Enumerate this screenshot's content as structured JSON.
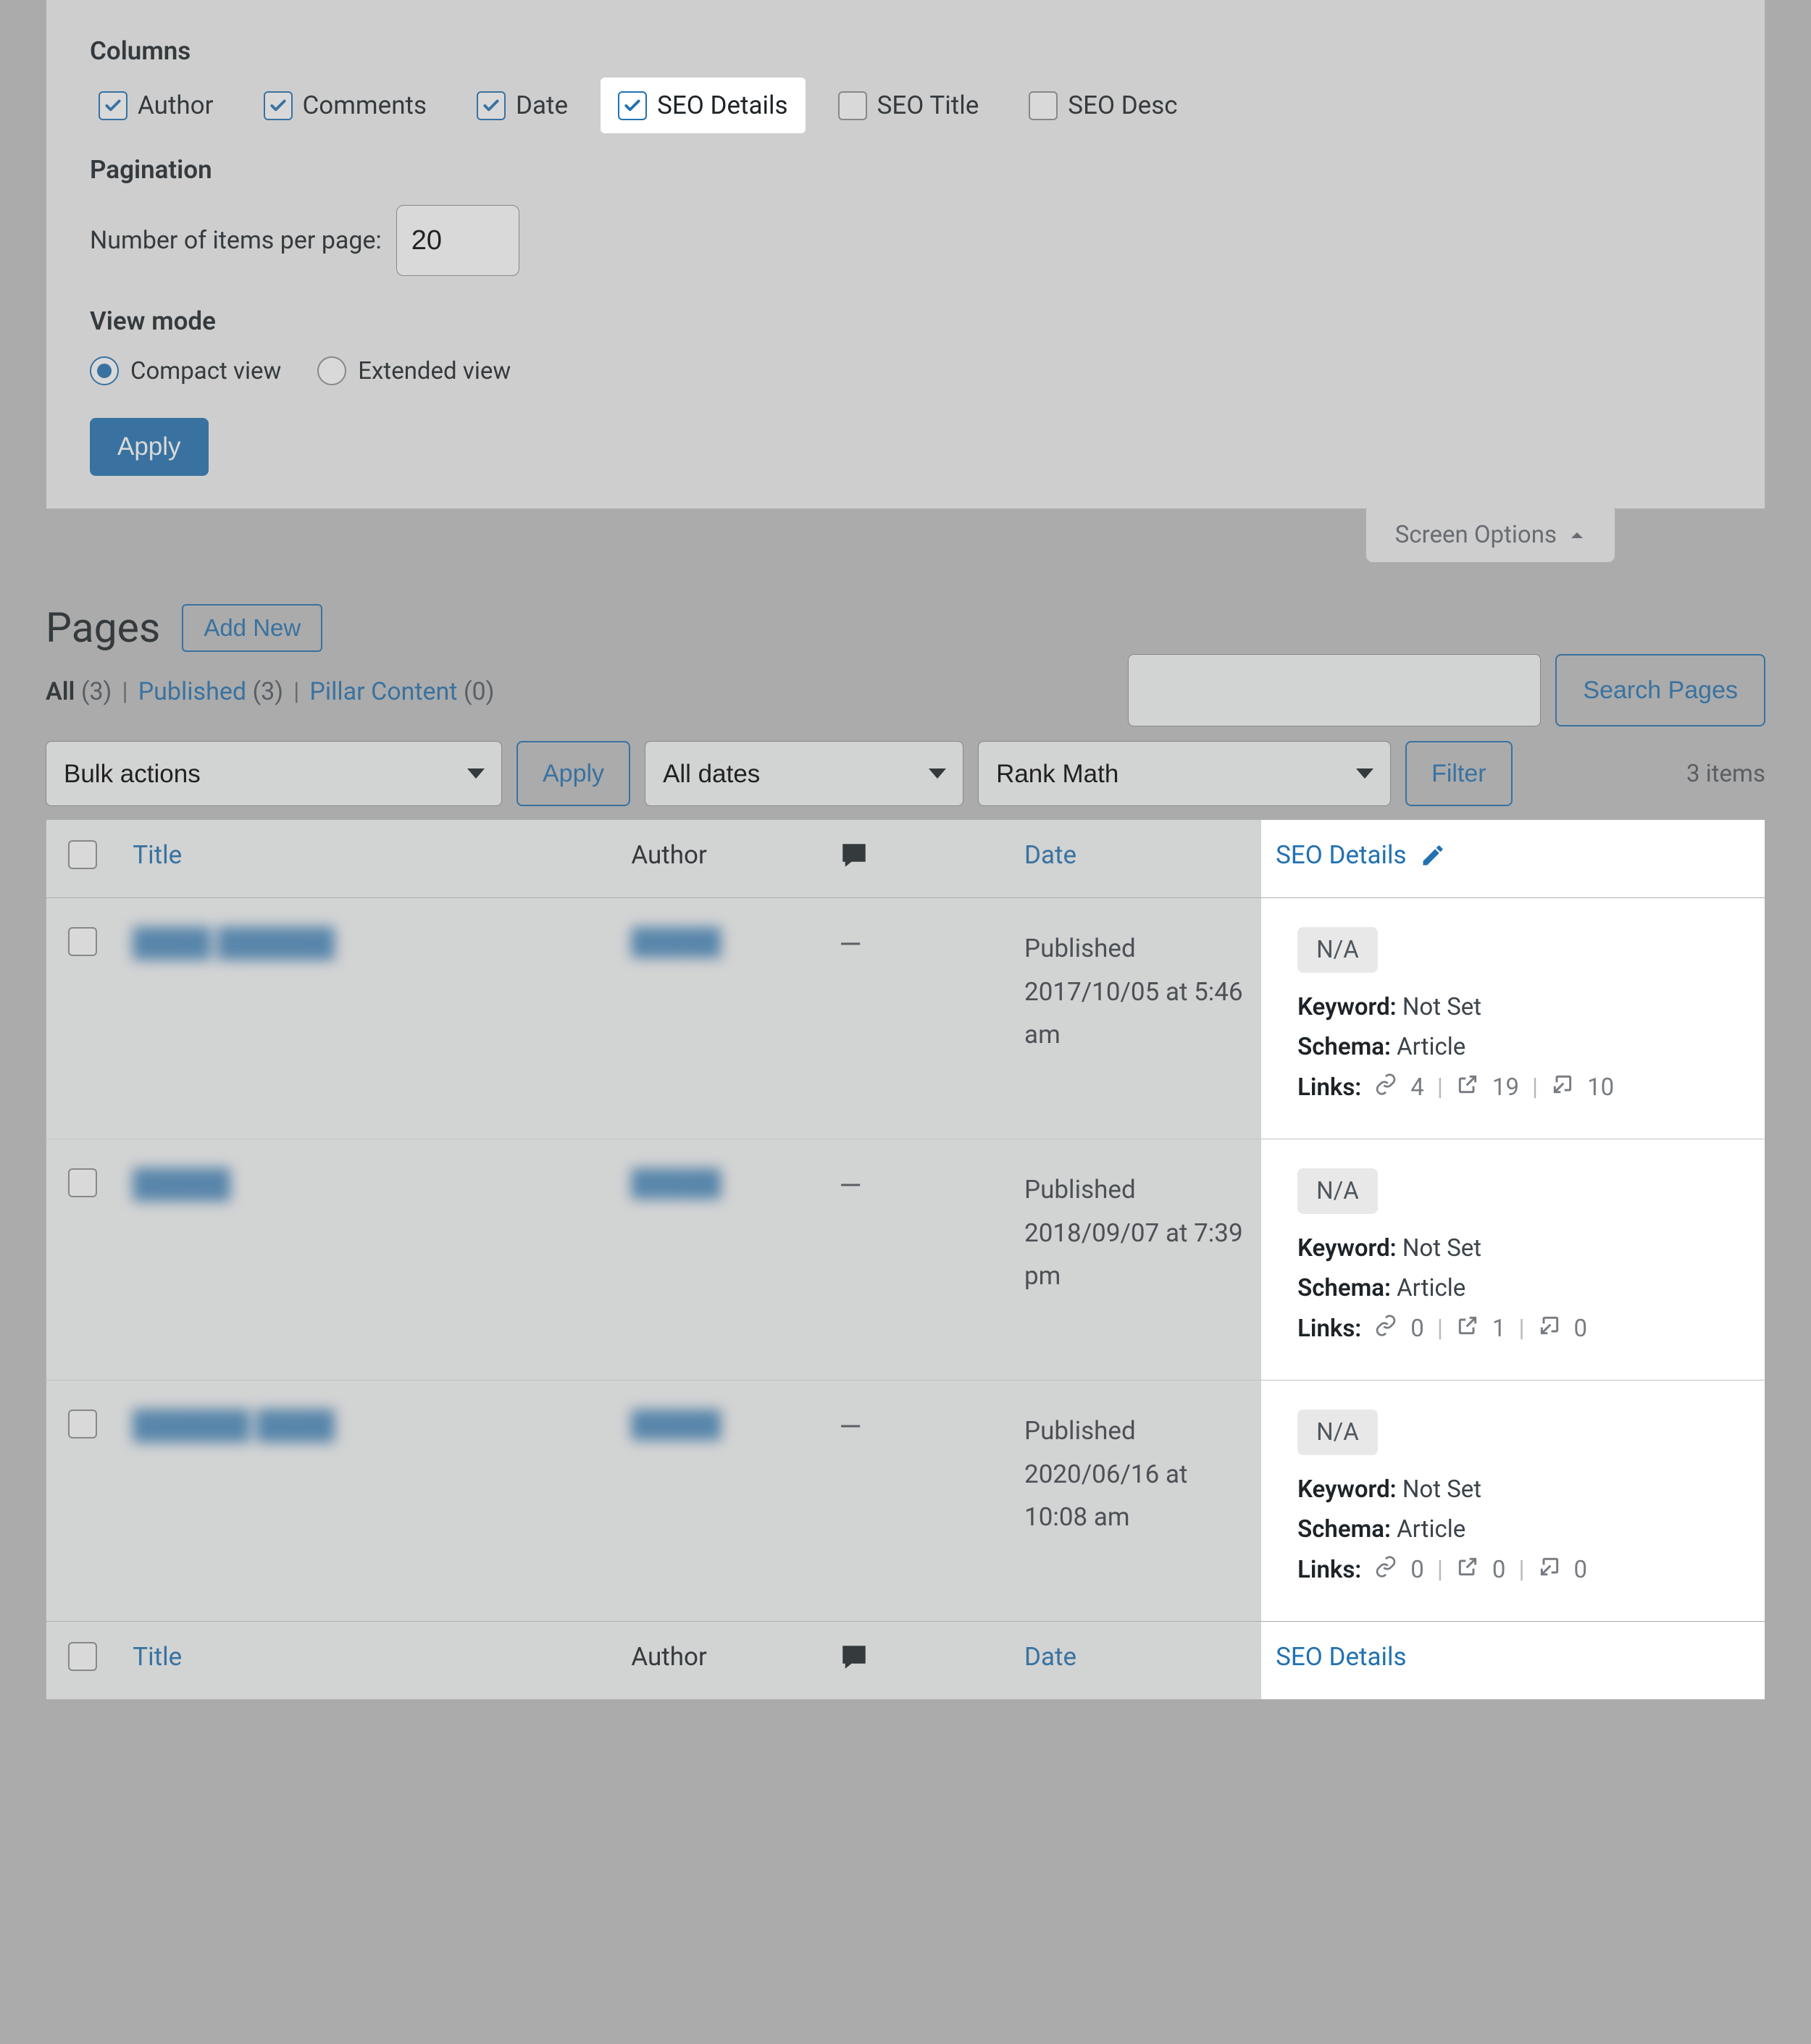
{
  "screenOptions": {
    "columnsHeading": "Columns",
    "columns": [
      {
        "label": "Author",
        "checked": true,
        "highlight": false
      },
      {
        "label": "Comments",
        "checked": true,
        "highlight": false
      },
      {
        "label": "Date",
        "checked": true,
        "highlight": false
      },
      {
        "label": "SEO Details",
        "checked": true,
        "highlight": true
      },
      {
        "label": "SEO Title",
        "checked": false,
        "highlight": false
      },
      {
        "label": "SEO Desc",
        "checked": false,
        "highlight": false
      }
    ],
    "paginationHeading": "Pagination",
    "perPageLabel": "Number of items per page:",
    "perPageValue": "20",
    "viewModeHeading": "View mode",
    "viewModes": [
      {
        "label": "Compact view",
        "checked": true
      },
      {
        "label": "Extended view",
        "checked": false
      }
    ],
    "applyLabel": "Apply",
    "tabLabel": "Screen Options"
  },
  "page": {
    "title": "Pages",
    "addNew": "Add New"
  },
  "views": {
    "all": {
      "label": "All",
      "count": "(3)"
    },
    "published": {
      "label": "Published",
      "count": "(3)"
    },
    "pillar": {
      "label": "Pillar Content",
      "count": "(0)"
    }
  },
  "search": {
    "button": "Search Pages"
  },
  "tablenav": {
    "bulk": "Bulk actions",
    "apply": "Apply",
    "dates": "All dates",
    "rankmath": "Rank Math",
    "filter": "Filter",
    "itemsCount": "3 items"
  },
  "table": {
    "headers": {
      "title": "Title",
      "author": "Author",
      "date": "Date",
      "seo": "SEO Details"
    },
    "rows": [
      {
        "title": "████ ██████",
        "author": "█████",
        "dateStatus": "Published",
        "dateLine": "2017/10/05 at 5:46 am",
        "seo": {
          "badge": "N/A",
          "keyword": "Not Set",
          "schema": "Article",
          "links": {
            "internal": "4",
            "external": "19",
            "incoming": "10"
          }
        }
      },
      {
        "title": "█████",
        "author": "█████",
        "dateStatus": "Published",
        "dateLine": "2018/09/07 at 7:39 pm",
        "seo": {
          "badge": "N/A",
          "keyword": "Not Set",
          "schema": "Article",
          "links": {
            "internal": "0",
            "external": "1",
            "incoming": "0"
          }
        }
      },
      {
        "title": "██████ ████",
        "author": "█████",
        "dateStatus": "Published",
        "dateLine": "2020/06/16 at 10:08 am",
        "seo": {
          "badge": "N/A",
          "keyword": "Not Set",
          "schema": "Article",
          "links": {
            "internal": "0",
            "external": "0",
            "incoming": "0"
          }
        }
      }
    ],
    "labels": {
      "keyword": "Keyword:",
      "schema": "Schema:",
      "links": "Links:"
    }
  }
}
